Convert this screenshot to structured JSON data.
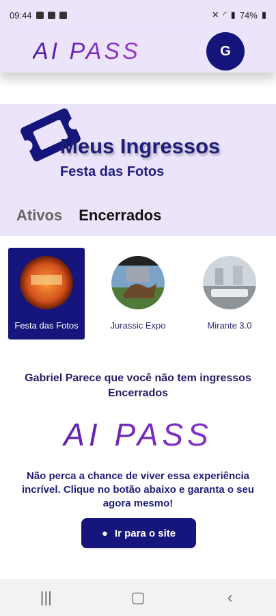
{
  "status_bar": {
    "time": "09:44",
    "battery": "74%",
    "icons": [
      "image-icon",
      "sim-icon",
      "check-icon",
      "mute-icon",
      "wifi-icon",
      "signal-icon",
      "battery-icon"
    ]
  },
  "header": {
    "logo_text": "AI PASS",
    "avatar_initial": "G"
  },
  "hero": {
    "title": "Meus Ingressos",
    "subtitle": "Festa das Fotos",
    "icon": "ticket-icon"
  },
  "tabs": [
    {
      "label": "Ativos",
      "active": false
    },
    {
      "label": "Encerrados",
      "active": true
    }
  ],
  "events": [
    {
      "label": "Festa das Fotos",
      "active": true
    },
    {
      "label": "Jurassic Expo",
      "active": false
    },
    {
      "label": "Mirante 3.0",
      "active": false
    }
  ],
  "empty_state": {
    "line1": "Gabriel Parece que você não tem ingressos",
    "line2": "Encerrados"
  },
  "promo": {
    "logo_text": "AI PASS",
    "text": "Não perca a chance de viver essa experiência incrível. Clique no botão abaixo e garanta o seu agora mesmo!",
    "button_label": "Ir para o site"
  },
  "nav": {
    "icons": [
      "recent-apps-icon",
      "home-icon",
      "back-icon"
    ]
  },
  "colors": {
    "primary": "#15157b",
    "background_light": "#ece4fb",
    "logo_gradient_start": "#4b1aa6",
    "logo_gradient_end": "#9a3ad0"
  }
}
